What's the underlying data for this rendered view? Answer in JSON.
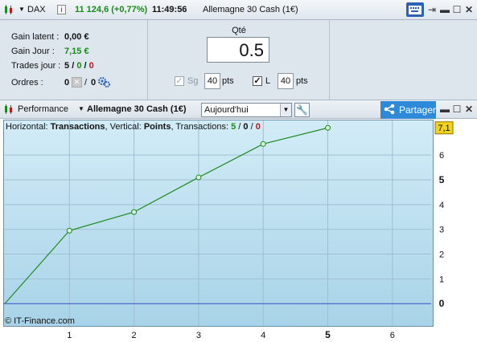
{
  "titlebar": {
    "symbol": "DAX",
    "info_icon": "info-icon",
    "price": "11 124,6 (+0,77%)",
    "time": "11:49:56",
    "instrument": "Allemagne 30 Cash (1€)"
  },
  "stats": {
    "gain_latent_label": "Gain latent :",
    "gain_latent_value": "0,00 €",
    "gain_jour_label": "Gain Jour :",
    "gain_jour_value": "7,15 €",
    "trades_label": "Trades jour :",
    "trades_total": "5",
    "trades_win": "0",
    "trades_loss": "0",
    "ordres_label": "Ordres :",
    "ordres_a": "0",
    "ordres_b": "0"
  },
  "order": {
    "qte_label": "Qté",
    "qte_value": "0.5",
    "sg_label": "Sg",
    "sg_value": "40",
    "sg_unit": "pts",
    "l_label": "L",
    "l_value": "40",
    "l_unit": "pts"
  },
  "toolbar": {
    "performance_label": "Performance",
    "instrument_label": "Allemagne 30 Cash (1€)",
    "period_value": "Aujourd'hui",
    "share_label": "Partager"
  },
  "chart_header": {
    "horizontal_label": "Horizontal:",
    "horizontal_value": "Transactions",
    "vertical_label": "Vertical:",
    "vertical_value": "Points",
    "transactions_label": "Transactions:",
    "tx_total": "5",
    "tx_win": "0",
    "tx_loss": "0",
    "sep": "/"
  },
  "copyright": "© IT-Finance.com",
  "chart_data": {
    "type": "line",
    "x": [
      0,
      1,
      2,
      3,
      4,
      5
    ],
    "y": [
      0,
      2.95,
      3.7,
      5.1,
      6.45,
      7.1
    ],
    "xlim": [
      0,
      6.6
    ],
    "ylim": [
      -0.9,
      7.4
    ],
    "x_ticks": [
      "1",
      "2",
      "3",
      "4",
      "5",
      "6"
    ],
    "y_ticks": [
      "0",
      "1",
      "2",
      "3",
      "4",
      "5",
      "6"
    ],
    "last_value_label": "7,1",
    "zero_line": true,
    "grid": true,
    "colors": {
      "line": "#1e8a1e",
      "zero": "#3a4fd0",
      "last_label_bg": "#f2d21a"
    }
  }
}
